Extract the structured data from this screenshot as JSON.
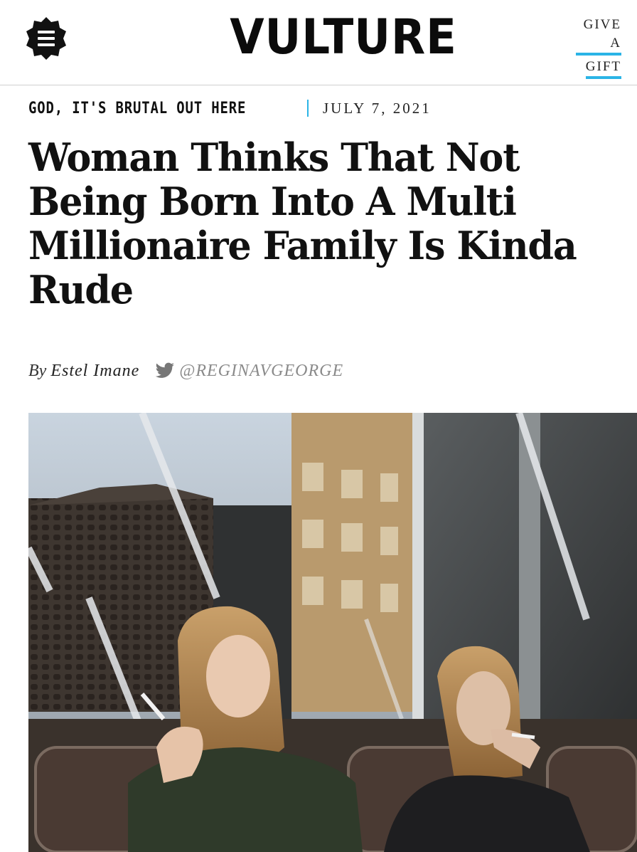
{
  "header": {
    "logo": "VULTURE",
    "gift_line1": "GIVE A",
    "gift_line2": "GIFT",
    "menu_icon": "hamburger-menu-icon"
  },
  "article": {
    "rubric": "GOD, IT'S BRUTAL OUT HERE",
    "date": "JULY 7, 2021",
    "headline": "Woman Thinks That Not Being Born Into A Multi Millionaire Family Is Kinda Rude",
    "byline_prefix": "By",
    "author": "Estel Imane",
    "twitter_handle": "@REGINAVGEORGE",
    "twitter_icon": "twitter-bird-icon"
  },
  "photo": {
    "description_icon": "article-photo"
  },
  "colors": {
    "accent": "#2bb4e6",
    "text": "#111111",
    "muted": "#8a8a8a"
  }
}
